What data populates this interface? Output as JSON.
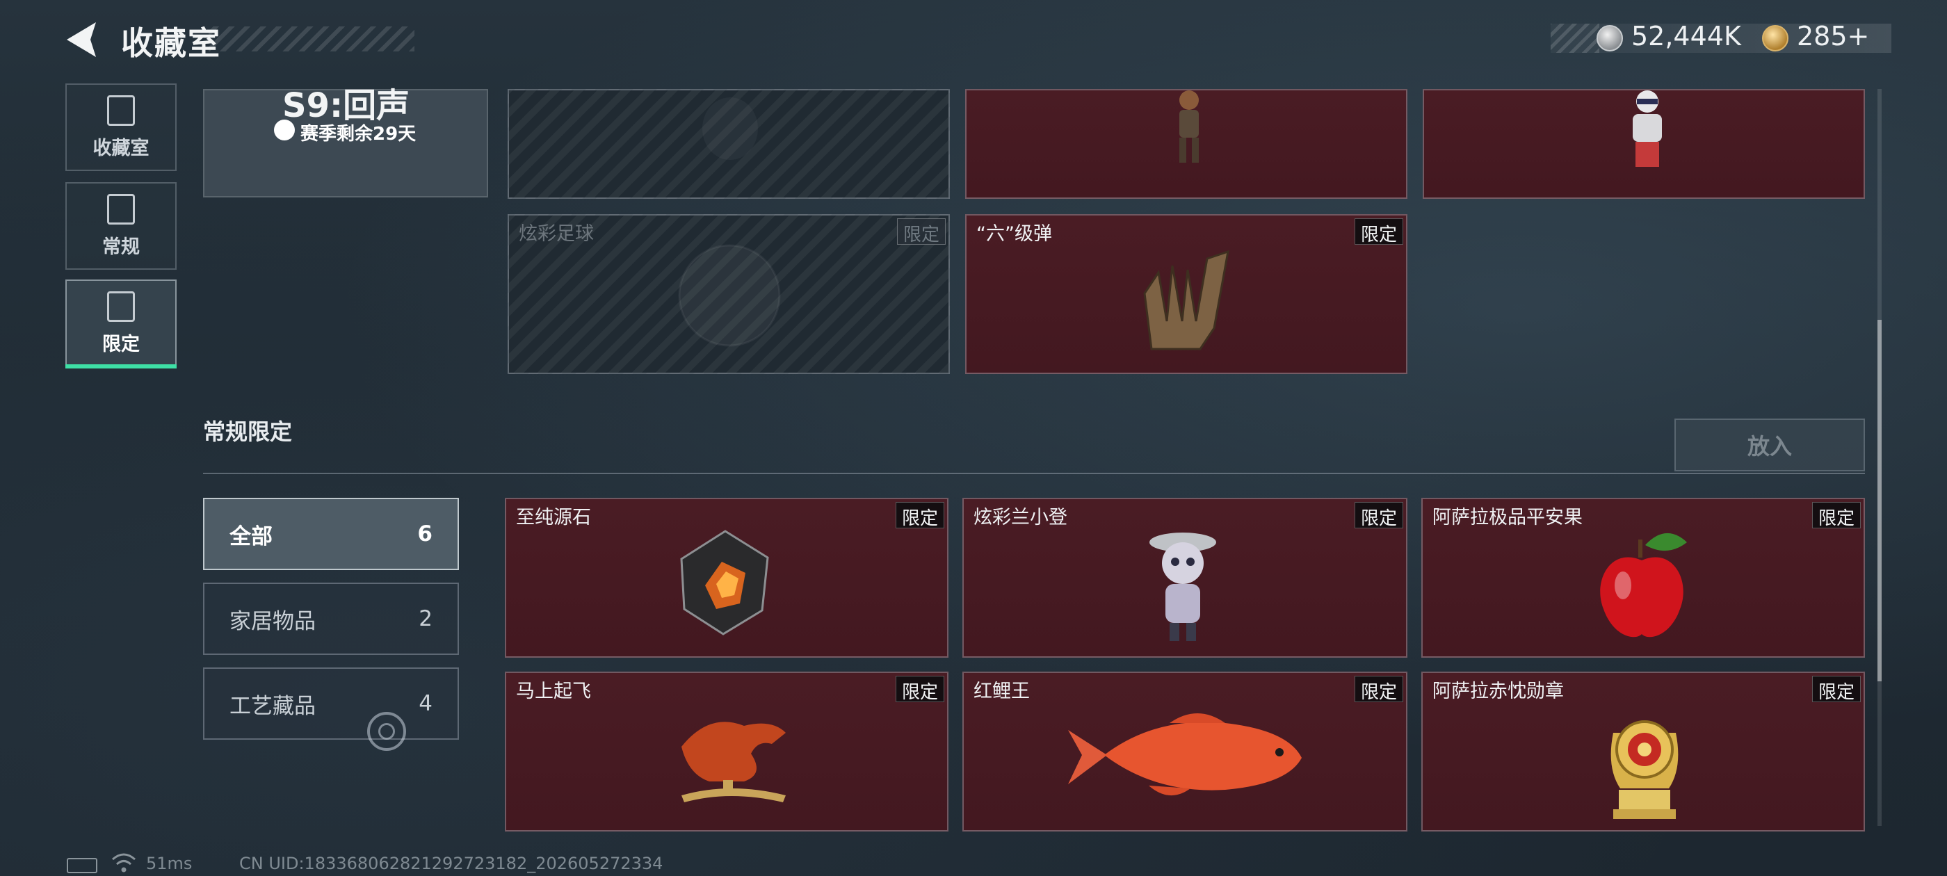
{
  "header": {
    "title": "收藏室",
    "currency": [
      {
        "icon": "silver-coin-icon",
        "value": "52,444K"
      },
      {
        "icon": "gold-coin-icon",
        "value": "285+"
      }
    ]
  },
  "nav": [
    {
      "label": "收藏室",
      "icon": "vault-icon",
      "active": false
    },
    {
      "label": "常规",
      "icon": "regular-icon",
      "active": false
    },
    {
      "label": "限定",
      "icon": "limited-icon",
      "active": true
    }
  ],
  "season": {
    "title": "S9:回声",
    "remain": "赛季剩余29天"
  },
  "top_cards": [
    {
      "name": "",
      "badge": "",
      "locked": true
    },
    {
      "name": "",
      "badge": "",
      "locked": false
    },
    {
      "name": "",
      "badge": "",
      "locked": false
    },
    {
      "name": "炫彩足球",
      "badge": "限定",
      "locked": true
    },
    {
      "name": "“六”级弹",
      "badge": "限定",
      "locked": false
    }
  ],
  "section": {
    "title": "常规限定",
    "put_button": "放入"
  },
  "filters": [
    {
      "label": "全部",
      "count": "6",
      "active": true
    },
    {
      "label": "家居物品",
      "count": "2",
      "active": false
    },
    {
      "label": "工艺藏品",
      "count": "4",
      "active": false
    }
  ],
  "items": [
    {
      "name": "至纯源石",
      "badge": "限定",
      "art": "source-stone-art"
    },
    {
      "name": "炫彩兰小登",
      "badge": "限定",
      "art": "figurine-art"
    },
    {
      "name": "阿萨拉极品平安果",
      "badge": "限定",
      "art": "apple-art"
    },
    {
      "name": "马上起飞",
      "badge": "限定",
      "art": "horse-art"
    },
    {
      "name": "红鲤王",
      "badge": "限定",
      "art": "carp-art"
    },
    {
      "name": "阿萨拉赤忱勋章",
      "badge": "限定",
      "art": "medal-art"
    }
  ],
  "footer": {
    "ping": "51ms",
    "uid": "CN UID:18336806282129272318​2_202605272334"
  },
  "colors": {
    "accent": "#3ee0a6",
    "card_red": "#4a1c24",
    "background": "#222d36"
  }
}
